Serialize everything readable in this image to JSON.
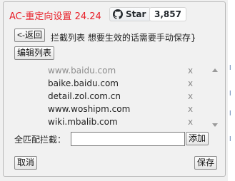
{
  "header": {
    "title": "AC-重定向设置 24.24",
    "github_label": "Star",
    "github_count": "3,857",
    "github_icon": "github-icon"
  },
  "toolbar": {
    "back_label": "<-返回",
    "hint": "拦截列表 想要生效的话需要手动保存}",
    "edit_label": "编辑列表"
  },
  "list": {
    "items": [
      {
        "host": "www.baidu.com",
        "remove": "x"
      },
      {
        "host": "baike.baidu.com",
        "remove": "x"
      },
      {
        "host": "detail.zol.com.cn",
        "remove": "x"
      },
      {
        "host": "www.woshipm.com",
        "remove": "x"
      },
      {
        "host": "wiki.mbalib.com",
        "remove": "x"
      }
    ]
  },
  "match": {
    "label": "全匹配拦截：",
    "value": "",
    "add_label": "添加"
  },
  "footer": {
    "cancel_label": "取消",
    "save_label": "保存"
  },
  "colors": {
    "title": "#e8202a",
    "panel_bg": "#f1f1f1"
  }
}
